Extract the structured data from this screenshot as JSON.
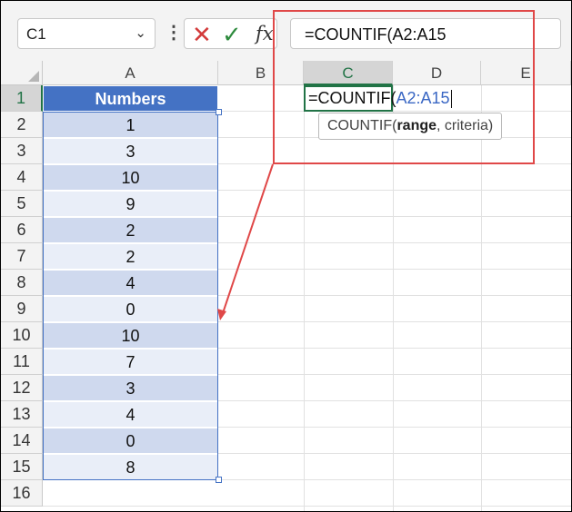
{
  "name_box": {
    "value": "C1"
  },
  "formula_bar": {
    "cancel_glyph": "✕",
    "enter_glyph": "✓",
    "fx_label": "fx",
    "formula": "=COUNTIF(A2:A15"
  },
  "columns": [
    "A",
    "B",
    "C",
    "D",
    "E"
  ],
  "selected_column": "C",
  "rows": [
    "1",
    "2",
    "3",
    "4",
    "5",
    "6",
    "7",
    "8",
    "9",
    "10",
    "11",
    "12",
    "13",
    "14",
    "15",
    "16"
  ],
  "selected_row": "1",
  "table": {
    "header": "Numbers",
    "values": [
      "1",
      "3",
      "10",
      "9",
      "2",
      "2",
      "4",
      "0",
      "10",
      "7",
      "3",
      "4",
      "0",
      "8"
    ]
  },
  "edit_cell": {
    "prefix": "=COUNTIF(",
    "range_ref": "A2:A15"
  },
  "tooltip": {
    "func": "COUNTIF(",
    "arg_bold": "range",
    "rest": ", criteria)"
  },
  "colors": {
    "header_fill": "#4472c4",
    "band_dark": "#cfd9ee",
    "band_light": "#e9eef8",
    "selection_green": "#217346",
    "annotation_red": "#e04848",
    "range_ref_blue": "#3a67c4"
  }
}
